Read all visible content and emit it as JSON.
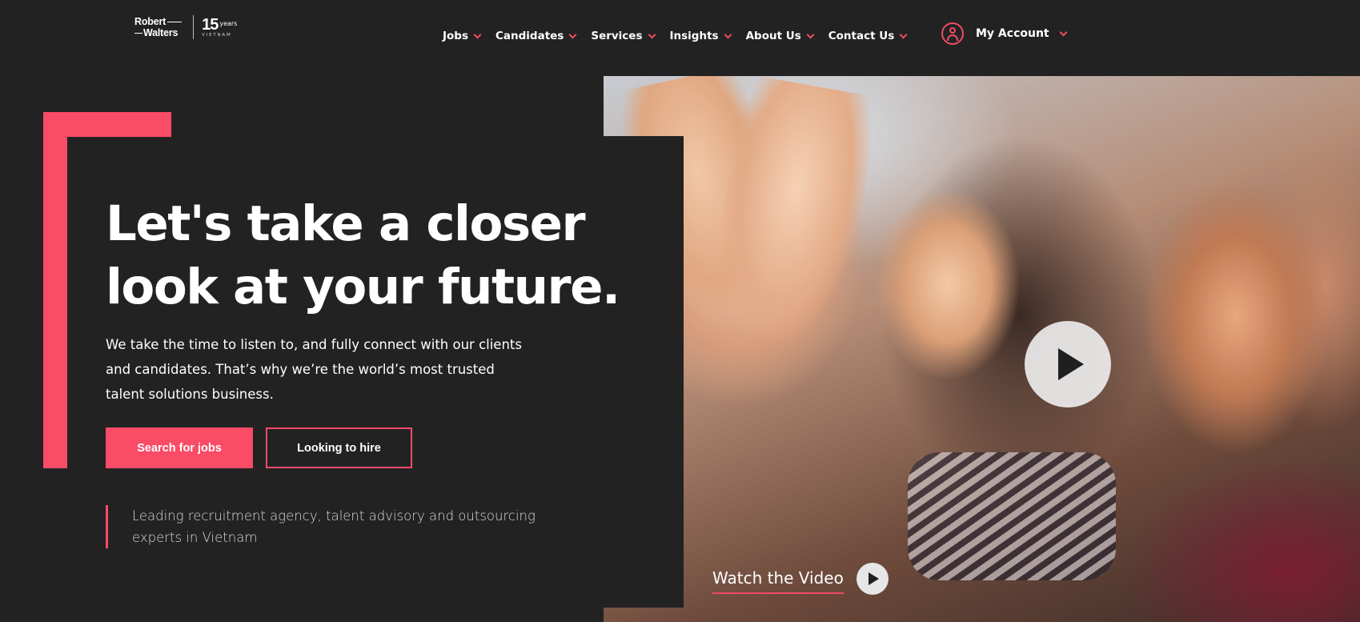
{
  "brand": {
    "logo_line1": "Robert",
    "logo_line2": "Walters",
    "years_number": "15",
    "years_label": "years",
    "country": "VIETNAM"
  },
  "nav": {
    "items": [
      {
        "label": "Jobs"
      },
      {
        "label": "Candidates"
      },
      {
        "label": "Services"
      },
      {
        "label": "Insights"
      },
      {
        "label": "About Us"
      },
      {
        "label": "Contact Us"
      }
    ],
    "account_label": "My Account"
  },
  "hero": {
    "title": "Let's take a closer look at your future.",
    "body": "We take the time to listen to, and fully connect with our clients and candidates. That’s why we’re the world’s most trusted talent solutions business.",
    "primary_button": "Search for jobs",
    "secondary_button": "Looking to hire",
    "tagline": "Leading recruitment agency, talent advisory and outsourcing experts in Vietnam",
    "video_label": "Watch the Video"
  },
  "colors": {
    "accent": "#fa4b67",
    "background": "#232223",
    "text": "#ffffff"
  },
  "icons": {
    "account": "user-circle-icon",
    "dropdown": "chevron-down-icon",
    "video": "play-icon"
  }
}
